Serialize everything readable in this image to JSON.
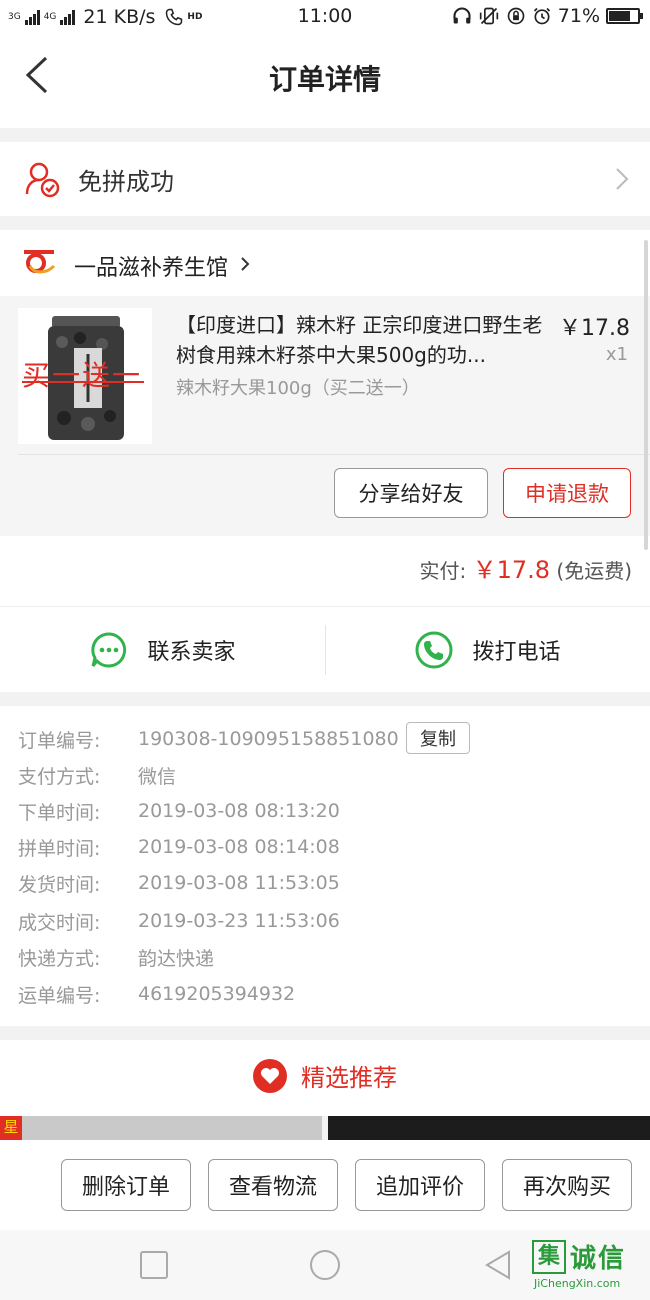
{
  "status_bar": {
    "net_3g": "3G",
    "net_4g": "4G",
    "speed": "21 KB/s",
    "hd": "HD",
    "time": "11:00",
    "battery": "71%",
    "battery_level": 0.71
  },
  "header": {
    "title": "订单详情"
  },
  "group_status": {
    "text": "免拼成功"
  },
  "store": {
    "name": "一品滋补养生馆"
  },
  "goods": {
    "image_text": "买一送一",
    "title": "【印度进口】辣木籽 正宗印度进口野生老树食用辣木籽茶中大果500g的功...",
    "spec": "辣木籽大果100g（买二送一）",
    "price": "￥17.8",
    "qty": "x1"
  },
  "actions": {
    "share": "分享给好友",
    "refund": "申请退款"
  },
  "payment": {
    "label": "实付:",
    "amount": "￥17.8",
    "note": "(免运费)"
  },
  "contact": {
    "seller": "联系卖家",
    "phone": "拨打电话"
  },
  "order_info": {
    "copy_label": "复制",
    "rows": [
      {
        "label": "订单编号:",
        "value": "190308-109095158851080"
      },
      {
        "label": "支付方式:",
        "value": "微信"
      },
      {
        "label": "下单时间:",
        "value": "2019-03-08 08:13:20"
      },
      {
        "label": "拼单时间:",
        "value": "2019-03-08 08:14:08"
      },
      {
        "label": "发货时间:",
        "value": "2019-03-08 11:53:05"
      },
      {
        "label": "成交时间:",
        "value": "2019-03-23 11:53:06"
      },
      {
        "label": "快递方式:",
        "value": "韵达快递"
      },
      {
        "label": "运单编号:",
        "value": "4619205394932"
      }
    ]
  },
  "recommend": {
    "title": "精选推荐",
    "thumb_tag": "星"
  },
  "bottom_actions": [
    "删除订单",
    "查看物流",
    "追加评价",
    "再次购买"
  ],
  "watermark": {
    "char": "集",
    "text": "诚信",
    "sub": "JiChengXin.com"
  },
  "colors": {
    "accent": "#e02e24",
    "wechat_green": "#2fb34a"
  }
}
